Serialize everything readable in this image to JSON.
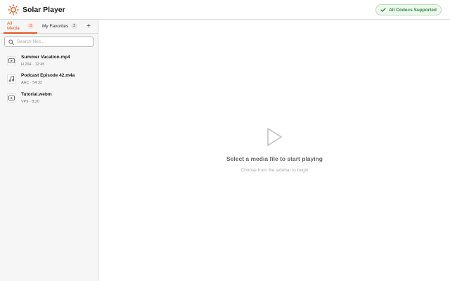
{
  "app": {
    "title": "Solar Player",
    "logo_icon": "sun-icon",
    "accent_color": "#e8541e"
  },
  "codec_badge": {
    "label": "All Codecs Supported",
    "icon": "check-icon",
    "color": "#2e8a3f"
  },
  "tabs": [
    {
      "label": "All Media",
      "count": "3",
      "active": true
    },
    {
      "label": "My Favorites",
      "count": "2",
      "active": false
    }
  ],
  "add_tab_label": "+",
  "search": {
    "placeholder": "Search files...",
    "value": ""
  },
  "files": [
    {
      "name": "Summer Vacation.mp4",
      "meta": "H.264 · 12:45",
      "icon": "video-icon"
    },
    {
      "name": "Podcast Episode 42.m4a",
      "meta": "AAC · 54:32",
      "icon": "music-note-icon"
    },
    {
      "name": "Tutorial.webm",
      "meta": "VP9 · 8:20",
      "icon": "video-icon"
    }
  ],
  "empty_state": {
    "icon": "play-icon",
    "title": "Select a media file to start playing",
    "subtitle": "Choose from the sidebar to begin"
  }
}
